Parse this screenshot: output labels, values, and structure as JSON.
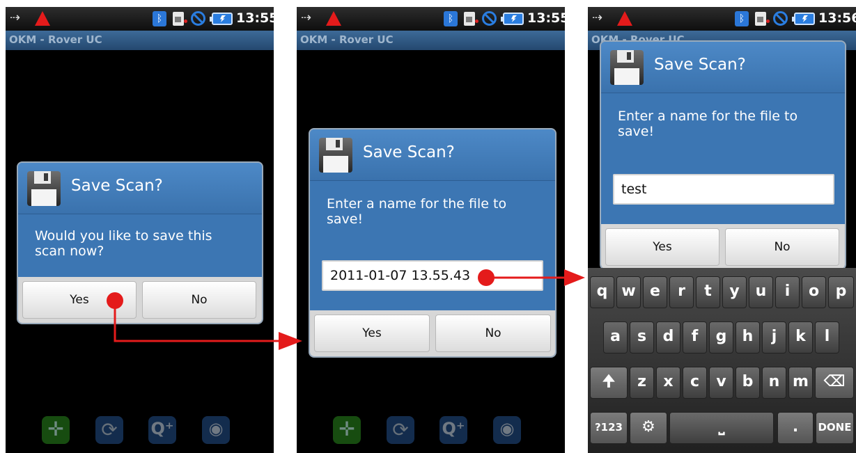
{
  "status_bar": {
    "time_1": "13:55",
    "time_2": "13:55",
    "time_3": "13:56"
  },
  "app_title": "OKM - Rover UC",
  "dialog": {
    "title": "Save Scan?",
    "confirm_message": "Would you like to save this scan now?",
    "name_prompt": "Enter a name for the file to save!",
    "yes_label": "Yes",
    "no_label": "No"
  },
  "screen2": {
    "filename_value": "2011-01-07 13.55.43"
  },
  "screen3": {
    "filename_value": "test"
  },
  "keyboard": {
    "row1": [
      "q",
      "w",
      "e",
      "r",
      "t",
      "y",
      "u",
      "i",
      "o",
      "p"
    ],
    "row2": [
      "a",
      "s",
      "d",
      "f",
      "g",
      "h",
      "j",
      "k",
      "l"
    ],
    "row3": [
      "z",
      "x",
      "c",
      "v",
      "b",
      "n",
      "m"
    ],
    "symbols_label": "?123",
    "period_label": ".",
    "done_label": "DONE"
  },
  "toolbar_icons": [
    "move-icon",
    "rotate-icon",
    "zoom-in-icon",
    "view-icon"
  ],
  "colors": {
    "annotation_arrow": "#e41b1b",
    "dialog_blue": "#3c76b3"
  }
}
